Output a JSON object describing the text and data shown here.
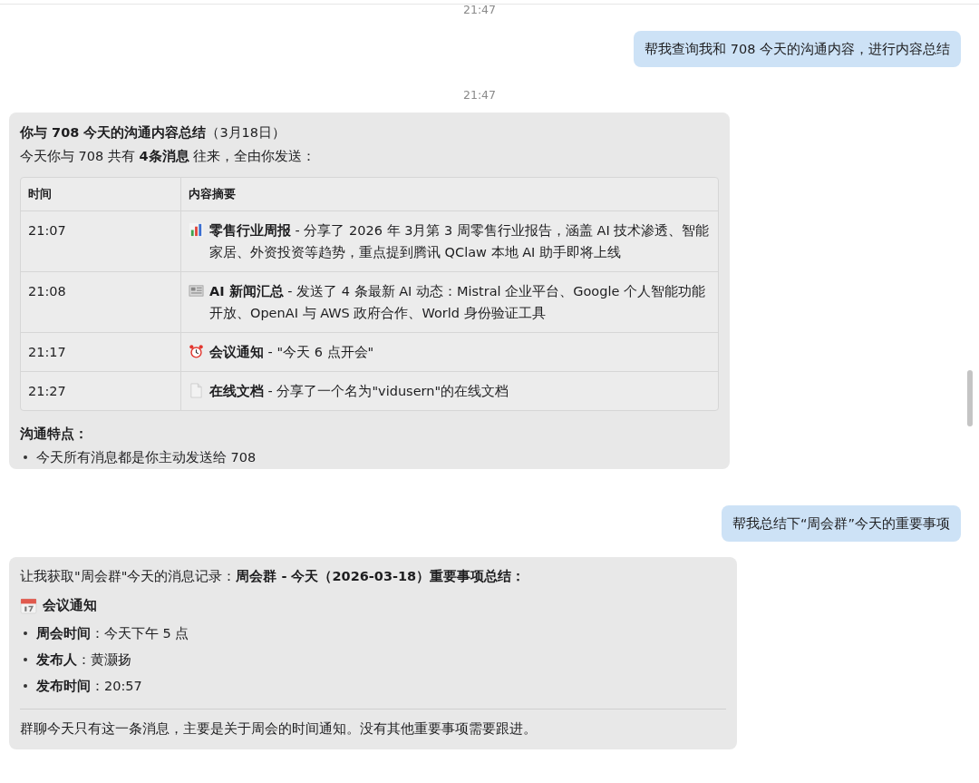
{
  "messages": [
    {
      "kind": "time",
      "text": "21:47"
    },
    {
      "kind": "user",
      "text": "帮我查询我和 708 今天的沟通内容，进行内容总结"
    },
    {
      "kind": "time",
      "text": "21:47"
    },
    {
      "kind": "assistant",
      "blocks": [
        {
          "kind": "paragraph",
          "text": "**你与 708 今天的沟通内容总结**（3月18日）"
        },
        {
          "kind": "paragraph",
          "text": "今天你与 708 共有 **4条消息** 往来，全由你发送："
        },
        {
          "kind": "table",
          "columns": [
            "时间",
            "内容摘要"
          ],
          "rows": [
            {
              "time": "21:07",
              "summary": "**零售行业周报** - 分享了 2026 年 3月第 3 周零售行业报告，涵盖 AI 技术渗透、智能家居、外资投资等趋势，重点提到腾讯 QClaw 本地 AI 助手即将上线"
            },
            {
              "time": "21:08",
              "summary": "**AI 新闻汇总** - 发送了 4 条最新 AI 动态：Mistral 企业平台、Google 个人智能功能开放、OpenAI 与 AWS 政府合作、World 身份验证工具"
            },
            {
              "time": "21:17",
              "summary": "**会议通知** - \"今天 6 点开会\""
            },
            {
              "time": "21:27",
              "summary": "**在线文档** - 分享了一个名为\"vidusern\"的在线文档"
            }
          ]
        },
        {
          "kind": "subheading",
          "text": "沟通特点："
        },
        {
          "kind": "bullets",
          "items": [
            "今天所有消息都是你主动发送给 708"
          ]
        }
      ]
    },
    {
      "kind": "user",
      "text": "帮我总结下“周会群”今天的重要事项"
    },
    {
      "kind": "assistant",
      "blocks": [
        {
          "kind": "paragraph",
          "text": "让我获取\"周会群\"今天的消息记录：**周会群 - 今天（2026-03-18）重要事项总结：**"
        },
        {
          "kind": "subheading",
          "text": "会议通知"
        },
        {
          "kind": "bullets",
          "items": [
            "**周会时间**：今天下午 5 点",
            "**发布人**：黄灏扬",
            "**发布时间**：20:57"
          ]
        },
        {
          "kind": "divider"
        },
        {
          "kind": "paragraph",
          "text": "群聊今天只有这一条消息，主要是关于周会的时间通知。没有其他重要事项需要跟进。"
        }
      ]
    }
  ]
}
